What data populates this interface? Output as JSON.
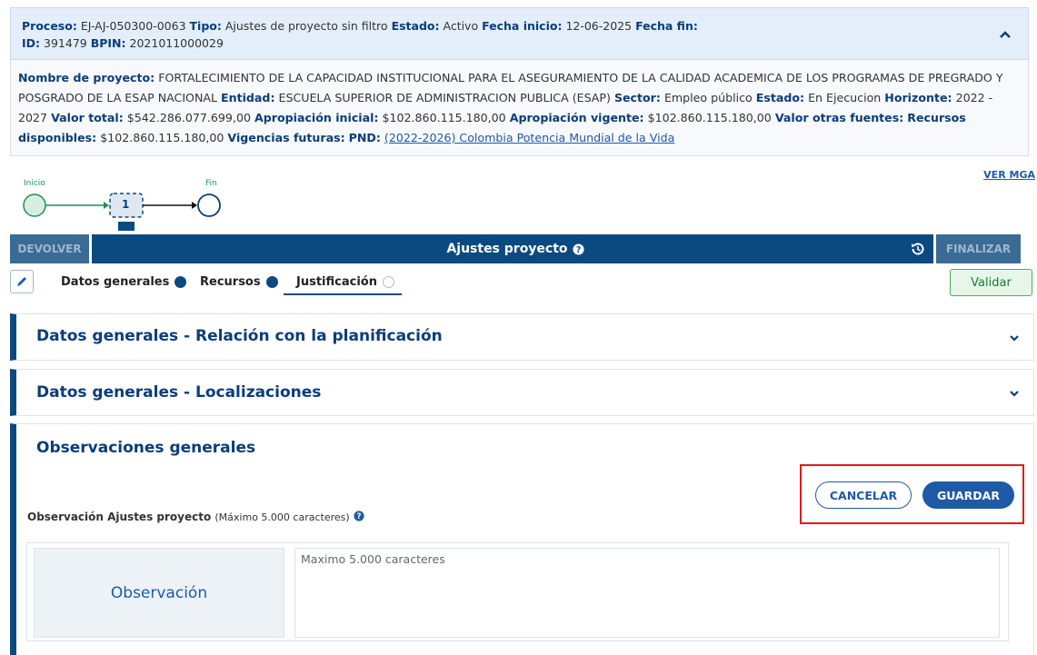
{
  "proceso": {
    "proceso_label": "Proceso:",
    "proceso_value": "EJ-AJ-050300-0063",
    "tipo_label": "Tipo:",
    "tipo_value": "Ajustes de proyecto sin filtro",
    "estado_label": "Estado:",
    "estado_value": "Activo",
    "fecha_inicio_label": "Fecha inicio:",
    "fecha_inicio_value": "12-06-2025",
    "fecha_fin_label": "Fecha fin:",
    "id_label": "ID:",
    "id_value": "391479",
    "bpin_label": "BPIN:",
    "bpin_value": "2021011000029"
  },
  "proyecto": {
    "nombre_label": "Nombre de proyecto:",
    "nombre_value": "FORTALECIMIENTO DE LA CAPACIDAD INSTITUCIONAL PARA EL ASEGURAMIENTO DE LA CALIDAD ACADEMICA DE LOS PROGRAMAS DE PREGRADO Y POSGRADO DE LA ESAP NACIONAL",
    "entidad_label": "Entidad:",
    "entidad_value": "ESCUELA SUPERIOR DE ADMINISTRACION PUBLICA (ESAP)",
    "sector_label": "Sector:",
    "sector_value": "Empleo público",
    "estado_label": "Estado:",
    "estado_value": "En Ejecucion",
    "horizonte_label": "Horizonte:",
    "horizonte_value": "2022 - 2027",
    "valor_total_label": "Valor total:",
    "valor_total_value": "$542.286.077.699,00",
    "apropiacion_inicial_label": "Apropiación inicial:",
    "apropiacion_inicial_value": "$102.860.115.180,00",
    "apropiacion_vigente_label": "Apropiación vigente:",
    "apropiacion_vigente_value": "$102.860.115.180,00",
    "valor_otras_label": "Valor otras fuentes:",
    "recursos_label": "Recursos disponibles:",
    "recursos_value": "$102.860.115.180,00",
    "vigencias_label": "Vigencias futuras:",
    "pnd_label": "PND:",
    "pnd_value": "(2022-2026) Colombia Potencia Mundial de la Vida"
  },
  "ver_mga": "VER MGA",
  "flow": {
    "inicio": "Inicio",
    "fin": "Fin",
    "step": "1"
  },
  "toolbar": {
    "devolver": "DEVOLVER",
    "title": "Ajustes proyecto",
    "finalizar": "FINALIZAR"
  },
  "tabs": [
    {
      "label": "Datos generales",
      "done": true
    },
    {
      "label": "Recursos",
      "done": true
    },
    {
      "label": "Justificación",
      "done": false
    }
  ],
  "validar": "Validar",
  "sections": [
    "Datos generales - Relación con la planificación",
    "Datos generales - Localizaciones",
    "Observaciones generales"
  ],
  "form": {
    "label": "Observación Ajustes proyecto",
    "note": "(Máximo 5.000 caracteres)",
    "cancel": "CANCELAR",
    "save": "GUARDAR",
    "obs_title": "Observación",
    "placeholder": "Maximo 5.000 caracteres"
  },
  "colors": {
    "primary": "#0b4a80",
    "accent": "#1f5aa6",
    "validate": "#4cae5f",
    "highlight": "#e21b1b"
  }
}
